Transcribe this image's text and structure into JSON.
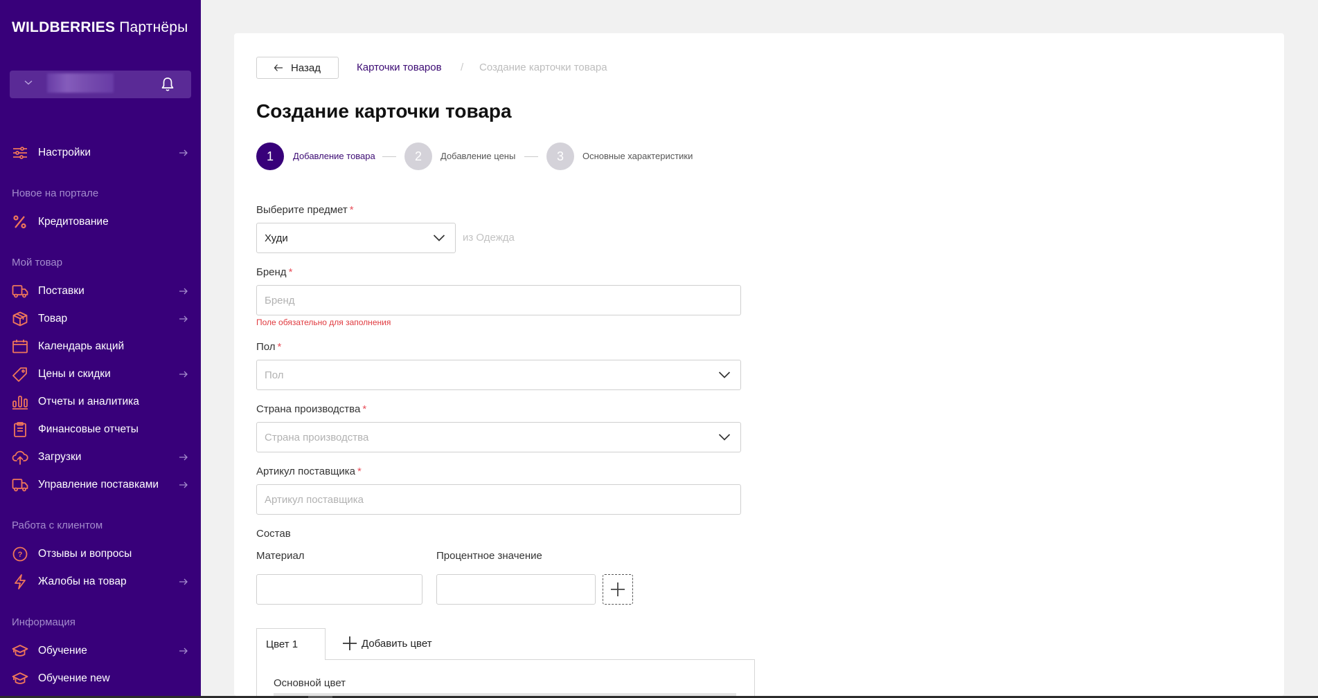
{
  "sidebar": {
    "logo_brand": "WILDBERRIES",
    "logo_suffix": "Партнёры",
    "account": {
      "name_blurred": true,
      "notifications_icon": "bell-icon"
    },
    "top_items": [
      {
        "label": "Настройки",
        "icon": "settings-sliders-icon",
        "has_arrow": true
      }
    ],
    "sections": [
      {
        "title": "Новое на портале",
        "items": [
          {
            "label": "Кредитование",
            "icon": "percent-icon",
            "has_arrow": false
          }
        ]
      },
      {
        "title": "Мой товар",
        "items": [
          {
            "label": "Поставки",
            "icon": "truck-icon",
            "has_arrow": true
          },
          {
            "label": "Товар",
            "icon": "box-icon",
            "has_arrow": true
          },
          {
            "label": "Календарь акций",
            "icon": "calendar-icon",
            "has_arrow": false
          },
          {
            "label": "Цены и скидки",
            "icon": "tag-icon",
            "has_arrow": true
          },
          {
            "label": "Отчеты и аналитика",
            "icon": "bar-chart-icon",
            "has_arrow": false
          },
          {
            "label": "Финансовые отчеты",
            "icon": "clipboard-icon",
            "has_arrow": false
          },
          {
            "label": "Загрузки",
            "icon": "cloud-upload-icon",
            "has_arrow": true
          },
          {
            "label": "Управление поставками",
            "icon": "truck-icon",
            "has_arrow": true
          }
        ]
      },
      {
        "title": "Работа с клиентом",
        "items": [
          {
            "label": "Отзывы и вопросы",
            "icon": "question-circle-icon",
            "has_arrow": false
          },
          {
            "label": "Жалобы на товар",
            "icon": "lightning-icon",
            "has_arrow": true
          }
        ]
      },
      {
        "title": "Информация",
        "items": [
          {
            "label": "Обучение",
            "icon": "graduation-cap-icon",
            "has_arrow": true
          },
          {
            "label": "Обучение new",
            "icon": "graduation-cap-icon",
            "has_arrow": false
          }
        ]
      }
    ]
  },
  "header": {
    "back_label": "Назад",
    "breadcrumb": [
      "Карточки товаров",
      "Создание карточки товара"
    ],
    "breadcrumb_separator": "/",
    "title": "Создание карточки товара"
  },
  "steps": [
    {
      "number": "1",
      "label": "Добавление товара",
      "active": true
    },
    {
      "number": "2",
      "label": "Добавление цены",
      "active": false
    },
    {
      "number": "3",
      "label": "Основные характеристики",
      "active": false
    }
  ],
  "form": {
    "subject": {
      "label": "Выберите предмет",
      "required": "*",
      "value": "Худи",
      "hint": "из Одежда"
    },
    "brand": {
      "label": "Бренд",
      "required": "*",
      "placeholder": "Бренд",
      "value": "",
      "error": "Поле обязательно для заполнения"
    },
    "gender": {
      "label": "Пол",
      "required": "*",
      "placeholder": "Пол",
      "value": ""
    },
    "country": {
      "label": "Страна производства",
      "required": "*",
      "placeholder": "Страна производства",
      "value": ""
    },
    "vendor_code": {
      "label": "Артикул поставщика",
      "required": "*",
      "placeholder": "Артикул поставщика",
      "value": ""
    },
    "composition": {
      "label": "Состав",
      "material_label": "Материал",
      "material_value": "",
      "percent_label": "Процентное значение",
      "percent_value": ""
    },
    "colors": {
      "tabs": [
        "Цвет 1"
      ],
      "add_label": "Добавить цвет",
      "main_color_label": "Основной цвет"
    }
  },
  "colors": {
    "sidebar_bg": "#38007a",
    "accent": "#38007a",
    "icon_orange": "#f0775a",
    "error": "#e0393e",
    "required": "#e8505b"
  }
}
